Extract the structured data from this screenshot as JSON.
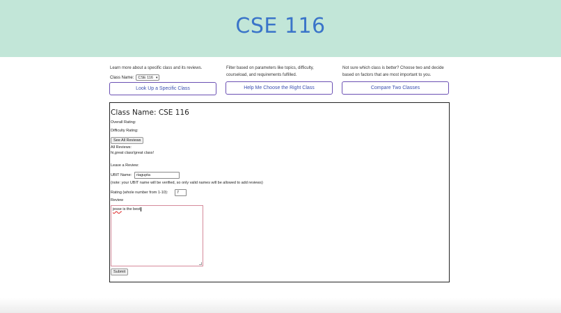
{
  "header": {
    "title": "CSE 116"
  },
  "columns": {
    "lookup": {
      "description": "Learn more about a specific class and its reviews.",
      "class_name_label": "Class Name:",
      "selected_class": "CSE 116",
      "button_label": "Look Up a Specific Class"
    },
    "filter": {
      "description": "Filter based on parameters like topics, difficulty, courseload, and requirements fulfilled.",
      "button_label": "Help Me Choose the Right Class"
    },
    "compare": {
      "description": "Not sure which class is better? Choose two and decide based on factors that are most important to you.",
      "button_label": "Compare Two Classes"
    }
  },
  "panel": {
    "title": "Class Name: CSE 116",
    "overall_rating_label": "Overall Rating:",
    "difficulty_rating_label": "Difficulty Rating:",
    "see_all_button": "See All Reviews",
    "all_reviews_label": "All Reviews:",
    "reviews_text": "hi,great class!great class!",
    "leave_review_label": "Leave a Review:",
    "ubit_label": "UBIT Name:",
    "ubit_value": "riagupta",
    "ubit_note": "(note: your UBIT name will be verified, so only valid names will be allowed to add reviews)",
    "rating_label": "Rating (whole number from 1-10):",
    "rating_value": "7",
    "review_label": "Review",
    "review_word1": "jesse",
    "review_rest": " is the best",
    "submit_button": "Submit"
  }
}
